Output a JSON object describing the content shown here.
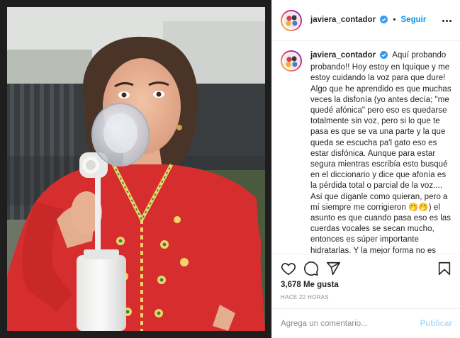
{
  "post": {
    "username": "javiera_contador",
    "follow_label": "Seguir",
    "separator": "•",
    "caption": "Aquí probando probando!! Hoy estoy en Iquique y me estoy cuidando la voz para que dure! Algo que he aprendido es que muchas veces la disfonía (yo antes decía; \"me quedé afónica\" pero eso es quedarse totalmente sin voz, pero si lo que te pasa es que se va una parte y la que queda se escucha pa'l gato eso es estar disfónica. Aunque para estar segura mientras escribía esto busqué en el diccionario y dice que afonía es la pérdida total o parcial de la voz.... Así que díganle como quieran, pero a mí siempre me corrigieron 🤭🤭) el asunto es que cuando pasa eso es las cuerdas vocales se secan mucho, entonces es súper importante hidratarlas. Y la mejor forma no es",
    "likes": "3,678 Me gusta",
    "timestamp": "HACE 22 HORAS"
  },
  "comment": {
    "placeholder": "Agrega un comentario...",
    "post_label": "Publicar"
  },
  "icons": {
    "verified": "verified-badge-icon",
    "more": "more-options-icon",
    "like": "heart-icon",
    "comment": "comment-bubble-icon",
    "share": "paper-plane-icon",
    "save": "bookmark-icon"
  },
  "colors": {
    "link_blue": "#0095f6",
    "post_button_disabled": "#b2dffc",
    "text_primary": "#262626",
    "text_secondary": "#8e8e8e",
    "border": "#efefef",
    "media_background": "#1e1e1e",
    "blouse_red": "#d62e2e"
  }
}
